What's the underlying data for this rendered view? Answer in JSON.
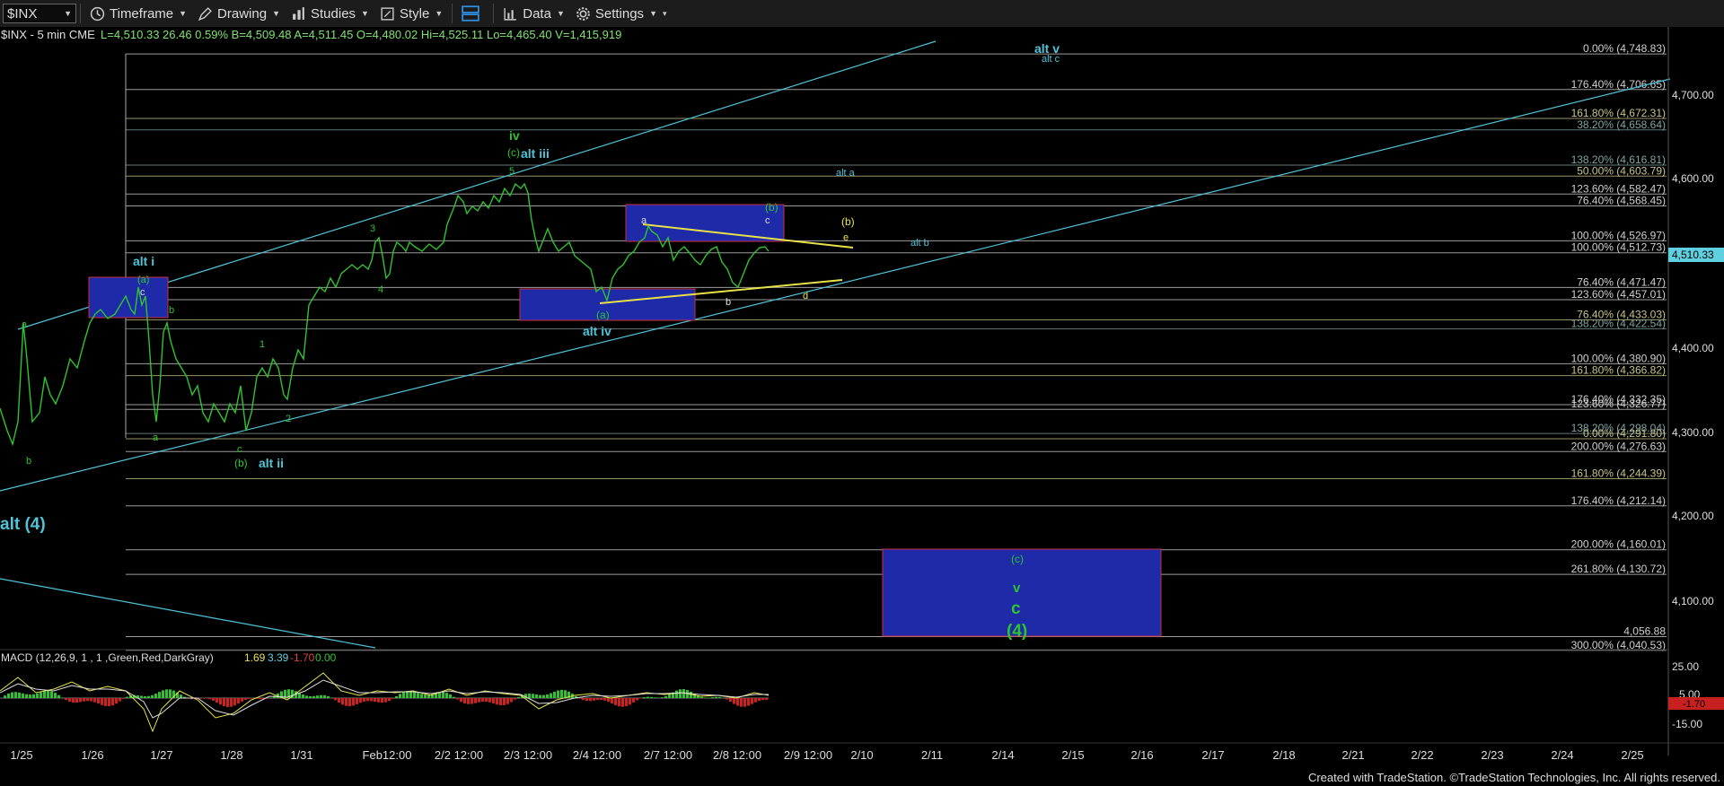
{
  "toolbar": {
    "symbol": "$INX",
    "timeframe": "Timeframe",
    "drawing": "Drawing",
    "studies": "Studies",
    "style": "Style",
    "data": "Data",
    "settings": "Settings"
  },
  "info": {
    "symbol_label": "$INX - 5 min  CME",
    "stats": "L=4,510.33  26.46  0.59%  B=4,509.48  A=4,511.45  O=4,480.02  Hi=4,525.11  Lo=4,465.40  V=1,415,919"
  },
  "price_axis": {
    "ticks": [
      "4,700.00",
      "4,600.00",
      "4,500.00",
      "4,400.00",
      "4,300.00",
      "4,200.00",
      "4,100.00"
    ],
    "last_price": "4,510.33",
    "last_price_color": "#5ed0e0"
  },
  "macd": {
    "label": "MACD (12,26,9, 1 , 1 ,Green,Red,DarkGray)",
    "v1": "1.69",
    "v2": "3.39",
    "v3": "-1.70",
    "v4": "0.00",
    "ticks": [
      "25.00",
      "5.00",
      "-15.00"
    ],
    "last_value": "-1.70"
  },
  "x_axis": {
    "labels": [
      "1/25",
      "1/26",
      "1/27",
      "1/28",
      "1/31",
      "Feb12:00",
      "2/2 12:00",
      "2/3 12:00",
      "2/4 12:00",
      "2/7 12:00",
      "2/8 12:00",
      "2/9 12:00",
      "2/10",
      "2/11",
      "2/14",
      "2/15",
      "2/16",
      "2/17",
      "2/18",
      "2/21",
      "2/22",
      "2/23",
      "2/24",
      "2/25"
    ]
  },
  "fib_levels": [
    {
      "text": "0.00% (4,748.83)",
      "price": 4748.83,
      "color": "#cfcfcf"
    },
    {
      "text": "176.40% (4,706.65)",
      "price": 4706.65,
      "color": "#cfcfcf"
    },
    {
      "text": "161.80% (4,672.31)",
      "price": 4672.31,
      "color": "#c8c38a"
    },
    {
      "text": "38.20% (4,658.64)",
      "price": 4658.64,
      "color": "#7fa4a0"
    },
    {
      "text": "138.20% (4,616.81)",
      "price": 4616.81,
      "color": "#7fa4a0"
    },
    {
      "text": "50.00% (4,603.79)",
      "price": 4603.79,
      "color": "#c8c38a"
    },
    {
      "text": "123.60% (4,582.47)",
      "price": 4582.47,
      "color": "#cfcfcf"
    },
    {
      "text": "76.40% (4,568.45)",
      "price": 4568.45,
      "color": "#cfcfcf"
    },
    {
      "text": "100.00% (4,526.97)",
      "price": 4526.97,
      "color": "#cfcfcf"
    },
    {
      "text": "100.00% (4,512.73)",
      "price": 4512.73,
      "color": "#cfcfcf"
    },
    {
      "text": "76.40% (4,471.47)",
      "price": 4471.47,
      "color": "#cfcfcf"
    },
    {
      "text": "123.60% (4,457.01)",
      "price": 4457.01,
      "color": "#cfcfcf"
    },
    {
      "text": "76.40% (4,433.03)",
      "price": 4433.03,
      "color": "#c8c38a"
    },
    {
      "text": "138.20% (4,422.54)",
      "price": 4422.54,
      "color": "#7fa4a0"
    },
    {
      "text": "100.00% (4,380.90)",
      "price": 4380.9,
      "color": "#cfcfcf"
    },
    {
      "text": "161.80% (4,366.82)",
      "price": 4366.82,
      "color": "#c8c38a"
    },
    {
      "text": "176.40% (4,332.35)",
      "price": 4332.35,
      "color": "#cfcfcf"
    },
    {
      "text": "123.60% (4,326.77)",
      "price": 4326.77,
      "color": "#cfcfcf"
    },
    {
      "text": "138.20% (4,298.04)",
      "price": 4298.04,
      "color": "#7fa4a0"
    },
    {
      "text": "0.00% (4,291.80)",
      "price": 4291.8,
      "color": "#c8c38a"
    },
    {
      "text": "200.00% (4,276.63)",
      "price": 4276.63,
      "color": "#cfcfcf"
    },
    {
      "text": "161.80% (4,244.39)",
      "price": 4244.39,
      "color": "#c8c38a"
    },
    {
      "text": "176.40% (4,212.14)",
      "price": 4212.14,
      "color": "#cfcfcf"
    },
    {
      "text": "200.00% (4,160.01)",
      "price": 4160.01,
      "color": "#cfcfcf"
    },
    {
      "text": "261.80% (4,130.72)",
      "price": 4130.72,
      "color": "#cfcfcf"
    },
    {
      "text": "4,056.88",
      "price": 4056.88,
      "color": "#cfcfcf"
    },
    {
      "text": "300.00% (4,040.53)",
      "price": 4040.53,
      "color": "#cfcfcf"
    }
  ],
  "wave_labels": {
    "alt_v": "alt v",
    "alt_c": "alt c",
    "iv": "iv",
    "c_paren": "(c)",
    "alt_iii": "alt iii",
    "n5": "5",
    "alt_a": "alt a",
    "alt_b": "alt b",
    "b_paren_green": "(b)",
    "c_small": "c",
    "a_small": "a",
    "b_paren_yellow": "(b)",
    "e_yellow": "e",
    "d_yellow": "d",
    "n3": "3",
    "n4": "4",
    "alt_i": "alt i",
    "a_paren_top": "(a)",
    "c_mid": "c",
    "b_mid": "b",
    "a_left": "a",
    "b_left": "b",
    "a_dip": "a",
    "n1": "1",
    "n2": "2",
    "c_low": "c",
    "b_paren_low": "(b)",
    "alt_ii": "alt ii",
    "a_paren_iv": "(a)",
    "alt_iv": "alt iv",
    "b_low2": "b",
    "alt_4": "alt (4)",
    "c_paren_target": "(c)",
    "v_target": "v",
    "c_target": "c",
    "four_paren": "(4)"
  },
  "footer": "Created with TradeStation. ©TradeStation Technologies, Inc. All rights reserved."
}
